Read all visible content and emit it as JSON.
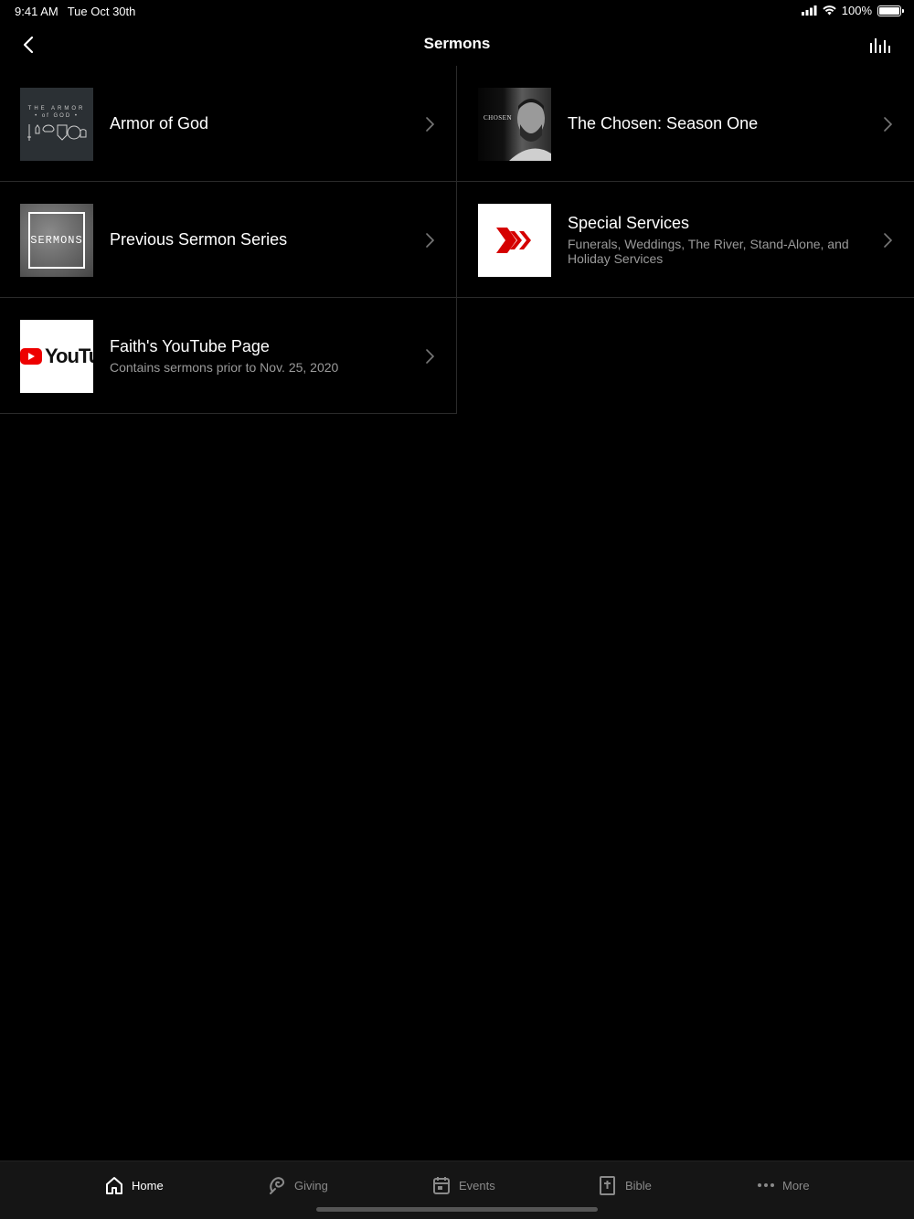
{
  "status_bar": {
    "time": "9:41 AM",
    "date": "Tue Oct 30th",
    "battery": "100%"
  },
  "nav": {
    "title": "Sermons"
  },
  "items": [
    {
      "title": "Armor of God",
      "subtitle": "",
      "thumb_line1": "THE ARMOR",
      "thumb_line2": "• of GOD •"
    },
    {
      "title": "The Chosen: Season One",
      "subtitle": "",
      "thumb_text": "CHOSEN"
    },
    {
      "title": "Previous Sermon Series",
      "subtitle": "",
      "thumb_text": "SERMONS"
    },
    {
      "title": "Special Services",
      "subtitle": "Funerals, Weddings, The River, Stand-Alone, and Holiday Services"
    },
    {
      "title": "Faith's YouTube Page",
      "subtitle": "Contains sermons prior to Nov. 25, 2020",
      "thumb_text": "YouTube"
    }
  ],
  "tabs": [
    {
      "label": "Home",
      "icon": "home-icon"
    },
    {
      "label": "Giving",
      "icon": "giving-icon"
    },
    {
      "label": "Events",
      "icon": "calendar-icon"
    },
    {
      "label": "Bible",
      "icon": "bible-icon"
    },
    {
      "label": "More",
      "icon": "more-icon"
    }
  ],
  "colors": {
    "background": "#000000",
    "accent_red": "#d50000",
    "subtitle_gray": "#9a9a9a",
    "divider": "#2a2a2a"
  }
}
